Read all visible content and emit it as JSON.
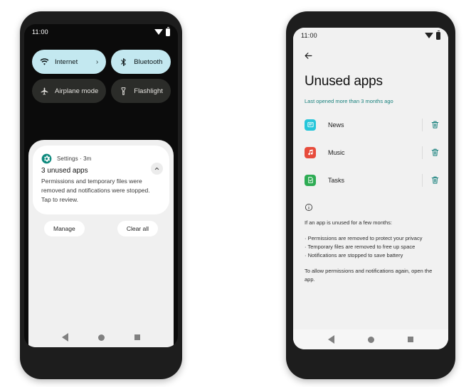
{
  "left_phone": {
    "status_bar": {
      "time": "11:00",
      "wifi_icon": "wifi-icon",
      "battery_icon": "battery-icon"
    },
    "quick_settings": {
      "tiles": [
        {
          "label": "Internet",
          "icon": "wifi-icon",
          "state": "on",
          "has_chevron": true,
          "chevron": "›"
        },
        {
          "label": "Bluetooth",
          "icon": "bluetooth-icon",
          "state": "on",
          "has_chevron": false,
          "chevron": ""
        },
        {
          "label": "Airplane mode",
          "icon": "airplane-icon",
          "state": "off",
          "has_chevron": false,
          "chevron": ""
        },
        {
          "label": "Flashlight",
          "icon": "flashlight-icon",
          "state": "off",
          "has_chevron": false,
          "chevron": ""
        }
      ],
      "on_color": "#c3e8f0",
      "off_color": "#2b2c29"
    },
    "notification": {
      "app_icon": "settings-gear-icon",
      "app_icon_color": "#0f8a7e",
      "app_line": "Settings · 3m",
      "title": "3 unused apps",
      "body": "Permissions and temporary files were removed and notifications were stopped. Tap to review.",
      "collapse_icon": "chevron-up-icon"
    },
    "actions": {
      "manage_label": "Manage",
      "clear_all_label": "Clear all"
    },
    "nav_bar": {
      "back": "back-triangle-icon",
      "home": "home-circle-icon",
      "recents": "recents-square-icon"
    }
  },
  "right_phone": {
    "status_bar": {
      "time": "11:00",
      "wifi_icon": "wifi-icon",
      "battery_icon": "battery-icon"
    },
    "back_icon": "back-arrow-icon",
    "title": "Unused apps",
    "subtitle": "Last opened more than 3 months ago",
    "subtitle_color": "#17807c",
    "apps": [
      {
        "name": "News",
        "icon": "news-app-icon",
        "color": "#26c6da",
        "delete_icon": "trash-icon"
      },
      {
        "name": "Music",
        "icon": "music-app-icon",
        "color": "#e74c3c",
        "delete_icon": "trash-icon"
      },
      {
        "name": "Tasks",
        "icon": "tasks-app-icon",
        "color": "#2eac54",
        "delete_icon": "trash-icon"
      }
    ],
    "delete_icon_color": "#17807c",
    "info": {
      "icon": "info-circle-icon",
      "intro": "If an app is unused for a few months:",
      "bullets": [
        "· Permissions are removed to protect your privacy",
        "· Temporary files are removed to free up space",
        "· Notifications are stopped to save battery"
      ],
      "outro": "To allow permissions and notifications again, open the app."
    },
    "nav_bar": {
      "back": "back-triangle-icon",
      "home": "home-circle-icon",
      "recents": "recents-square-icon"
    }
  }
}
